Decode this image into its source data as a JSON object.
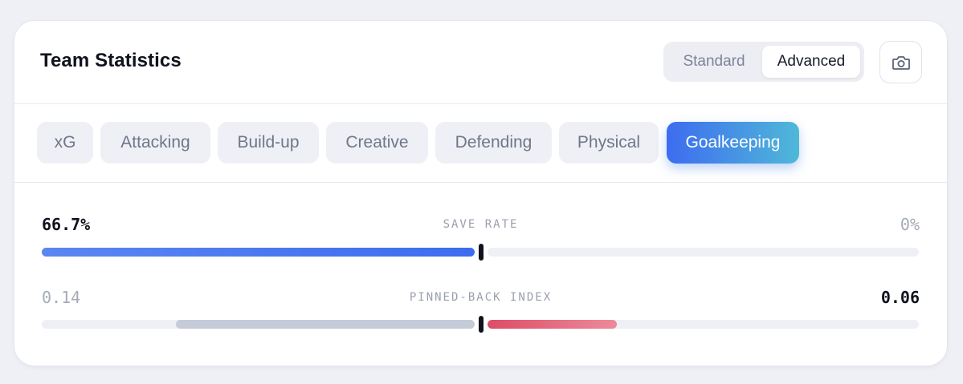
{
  "header": {
    "title": "Team Statistics",
    "view_toggle": {
      "options": [
        "Standard",
        "Advanced"
      ],
      "selected": "Advanced"
    },
    "camera_button_icon": "camera-icon"
  },
  "tabs": {
    "items": [
      "xG",
      "Attacking",
      "Build-up",
      "Creative",
      "Defending",
      "Physical",
      "Goalkeeping"
    ],
    "active": "Goalkeeping"
  },
  "metrics": [
    {
      "label": "SAVE RATE",
      "left_value": "66.7%",
      "right_value": "0%",
      "left_fraction": 1.0,
      "right_fraction": 0.0,
      "highlight": "left"
    },
    {
      "label": "PINNED-BACK INDEX",
      "left_value": "0.14",
      "right_value": "0.06",
      "left_fraction": 0.69,
      "right_fraction": 0.3,
      "highlight": "right"
    }
  ],
  "colors": {
    "accent_blue": "#3d6cf0",
    "accent_teal": "#4fb8d8",
    "muted_bar": "#c5cbd8",
    "red_bar": "#e0546c"
  }
}
